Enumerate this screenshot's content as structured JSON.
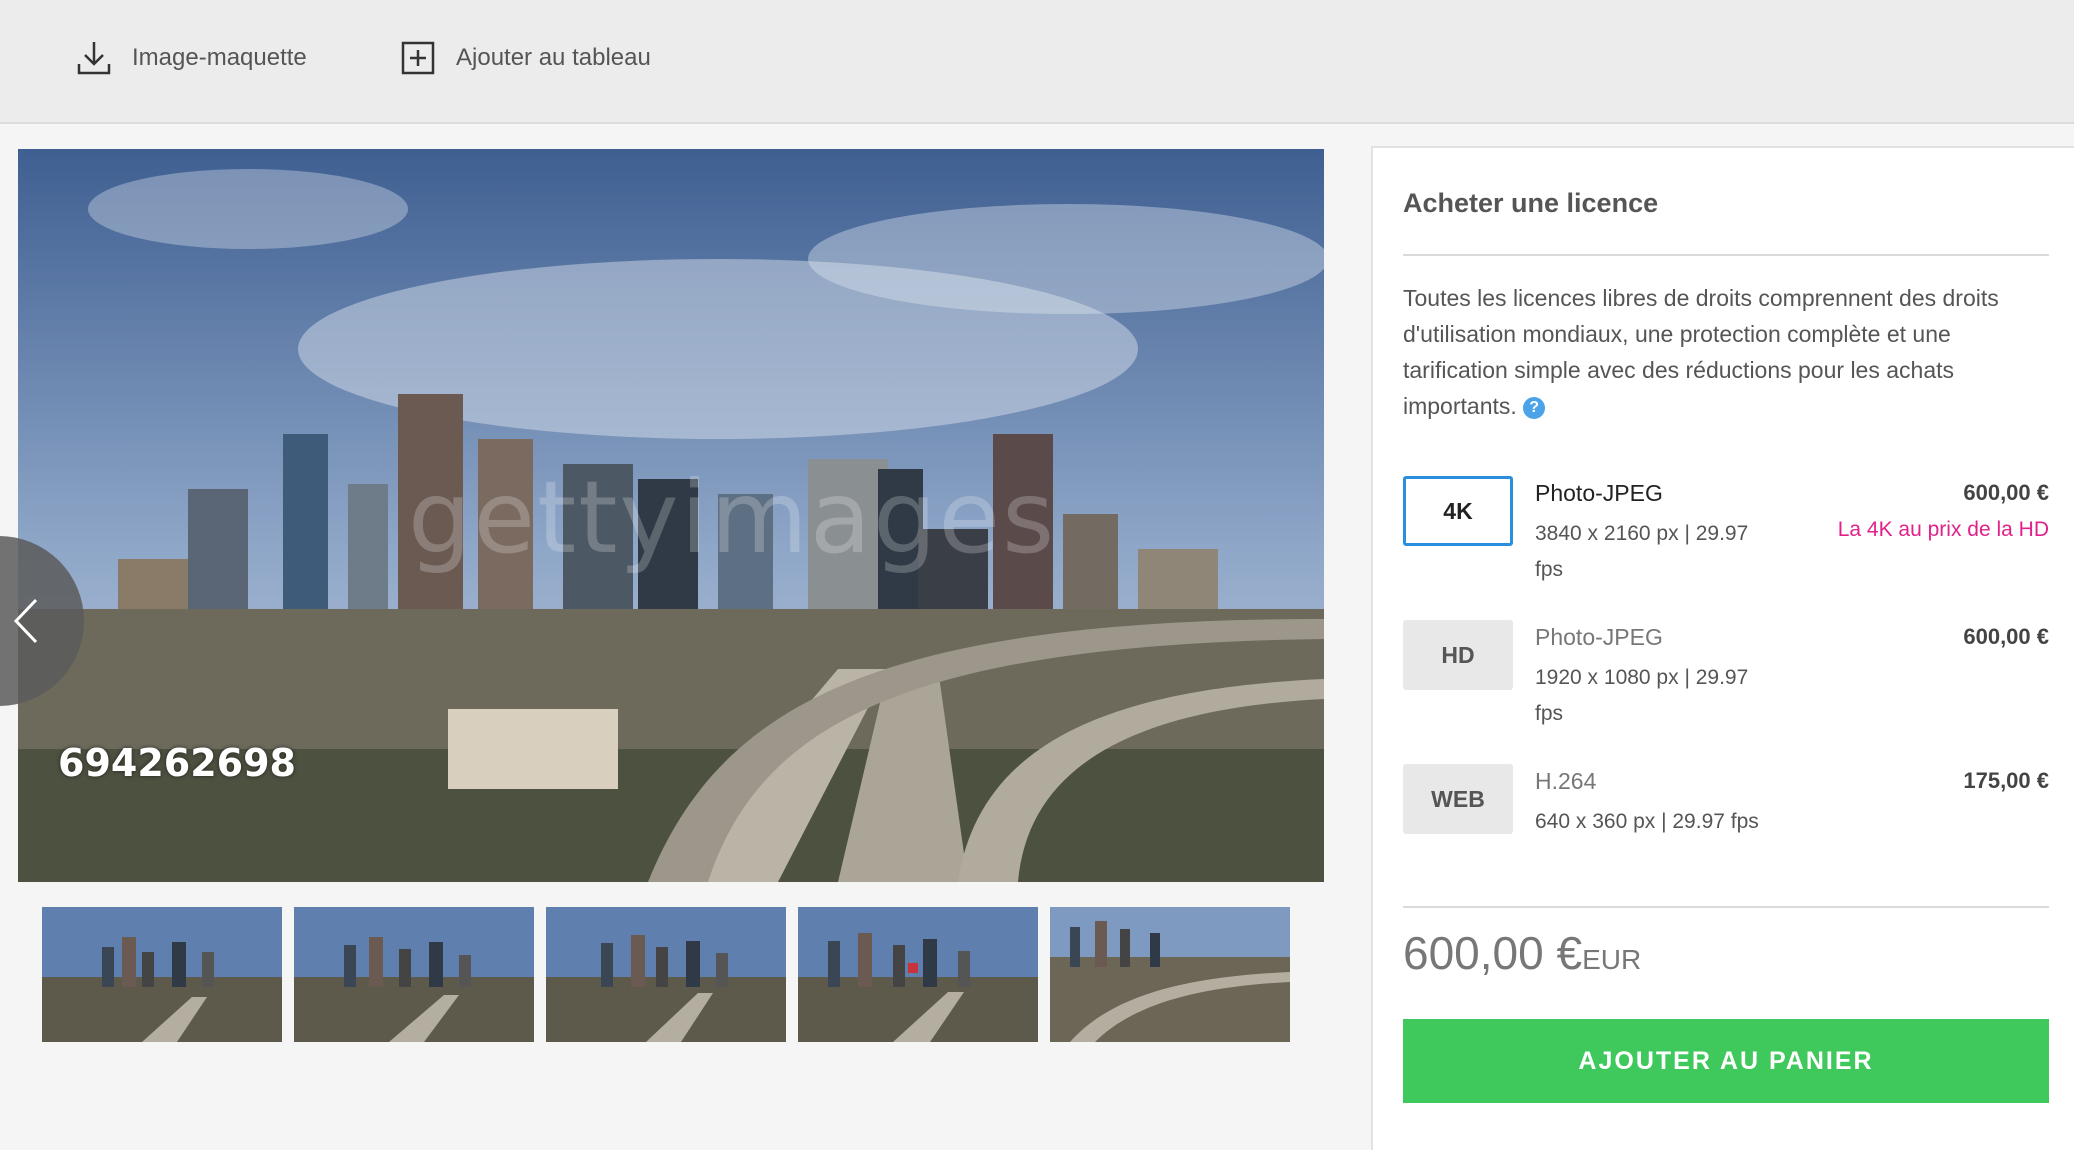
{
  "toolbar": {
    "download_label": "Image-maquette",
    "board_label": "Ajouter au tableau"
  },
  "media": {
    "watermark": "gettyimages",
    "video_id": "694262698",
    "thumbnail_count": 5
  },
  "license": {
    "title": "Acheter une licence",
    "description": "Toutes les licences libres de droits comprennent des droits d'utilisation mondiaux, une protection complète et une tarification simple avec des réductions pour les achats importants.",
    "help_glyph": "?",
    "options": [
      {
        "badge": "4K",
        "format": "Photo-JPEG",
        "spec": "3840 x 2160 px | 29.97 fps",
        "price": "600,00 €",
        "promo": "La 4K au prix de la HD",
        "selected": true
      },
      {
        "badge": "HD",
        "format": "Photo-JPEG",
        "spec": "1920 x 1080 px | 29.97 fps",
        "price": "600,00 €",
        "promo": "",
        "selected": false
      },
      {
        "badge": "WEB",
        "format": "H.264",
        "spec": "640 x 360 px | 29.97 fps",
        "price": "175,00 €",
        "promo": "",
        "selected": false
      }
    ],
    "total_amount": "600,00 €",
    "total_currency": "EUR",
    "cart_button": "AJOUTER AU PANIER"
  },
  "colors": {
    "accent_blue": "#2b8fe0",
    "cart_green": "#3fc95c",
    "promo_pink": "#e0218a"
  },
  "icons": [
    "download-icon",
    "add-to-board-icon",
    "chevron-left-icon",
    "help-icon"
  ]
}
